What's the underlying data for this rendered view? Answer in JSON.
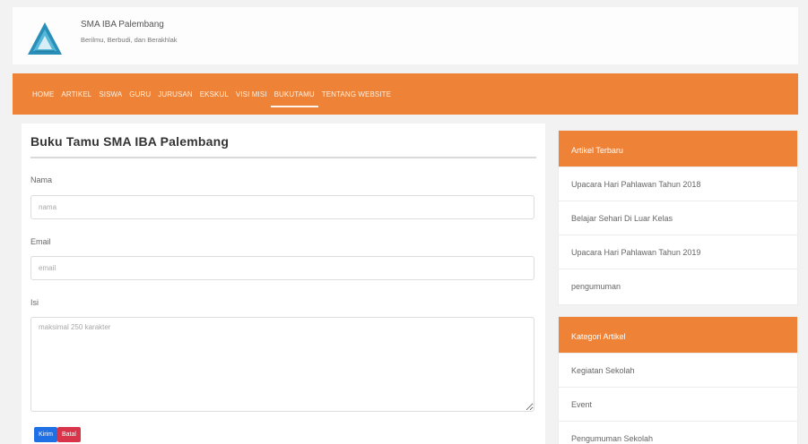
{
  "header": {
    "title": "SMA IBA Palembang",
    "tagline": "Berilmu, Berbudi, dan Berakhlak"
  },
  "nav": {
    "items": [
      "HOME",
      "ARTIKEL",
      "SISWA",
      "GURU",
      "JURUSAN",
      "EKSKUL",
      "VISI MISI",
      "BUKUTAMU",
      "TENTANG WEBSITE"
    ],
    "active": "BUKUTAMU"
  },
  "main": {
    "title": "Buku Tamu SMA IBA Palembang",
    "name_label": "Nama",
    "name_placeholder": "nama",
    "email_label": "Email",
    "email_placeholder": "email",
    "message_label": "Isi",
    "message_placeholder": "maksimal 250 karakter",
    "send_label": "Kirim",
    "cancel_label": "Batal"
  },
  "sidebar": {
    "latest": {
      "title": "Artikel Terbaru",
      "items": [
        "Upacara Hari Pahlawan Tahun 2018",
        "Belajar Sehari Di Luar Kelas",
        "Upacara Hari Pahlawan Tahun 2019",
        "pengumuman"
      ]
    },
    "categories": {
      "title": "Kategori Artikel",
      "items": [
        "Kegiatan Sekolah",
        "Event",
        "Pengumuman Sekolah"
      ]
    }
  },
  "colors": {
    "accent": "#ee8236",
    "send_button": "#1f6fe5",
    "cancel_button": "#d8344a"
  }
}
